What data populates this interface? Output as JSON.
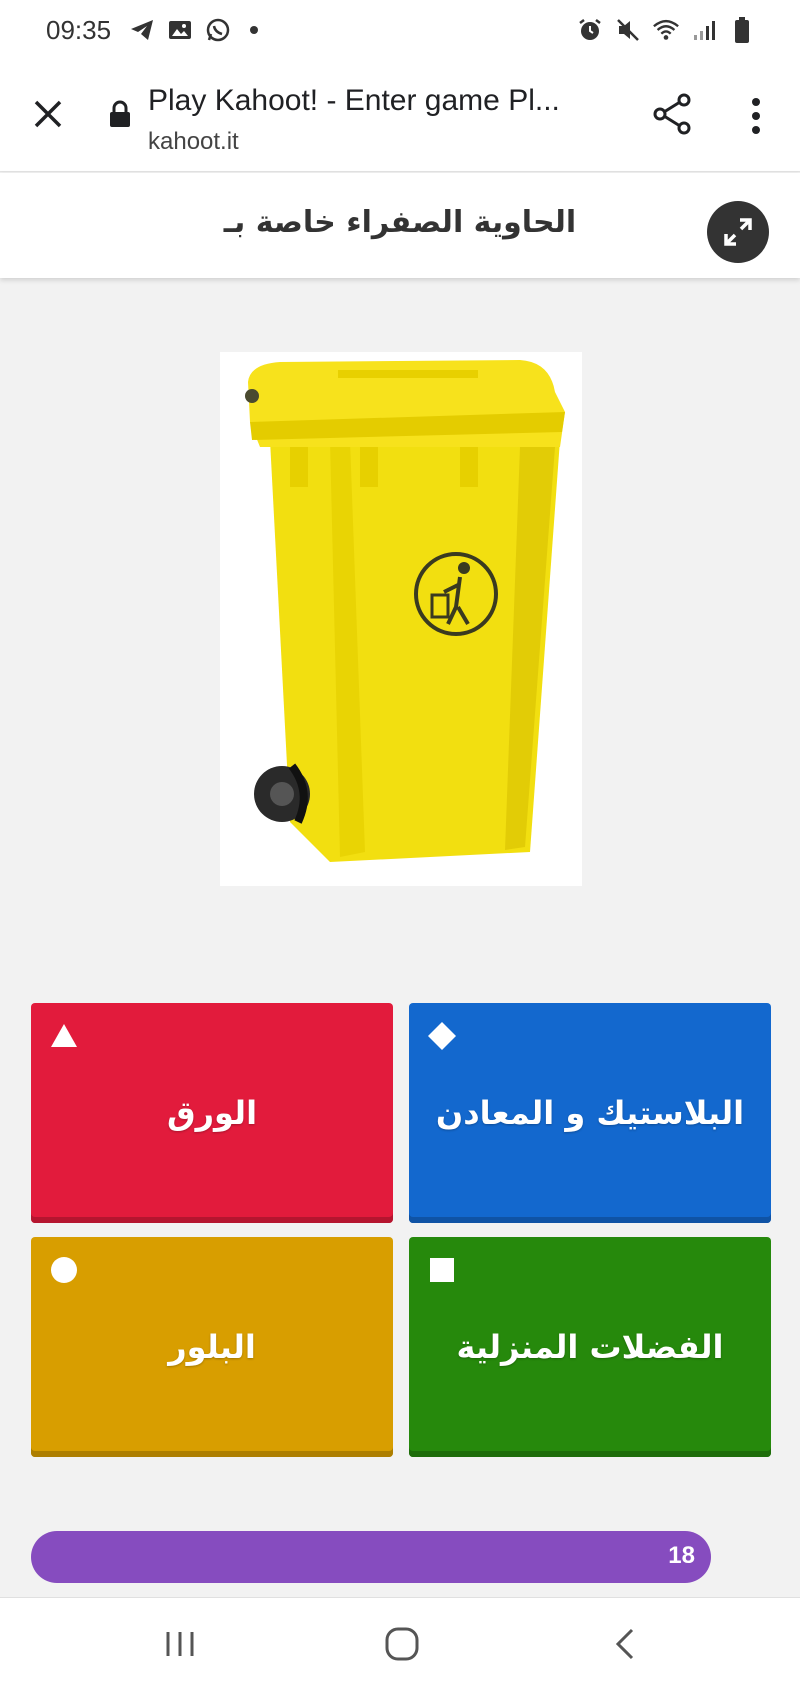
{
  "status_bar": {
    "time": "09:35",
    "left_icons": [
      "telegram-icon",
      "gallery-icon",
      "whatsapp-icon",
      "dot-icon"
    ],
    "right_icons": [
      "alarm-icon",
      "mute-icon",
      "wifi-icon",
      "signal-icon",
      "battery-icon"
    ]
  },
  "browser": {
    "title": "Play Kahoot! - Enter game Pl...",
    "url": "kahoot.it",
    "close_icon": "close-icon",
    "lock_icon": "lock-icon",
    "share_icon": "share-icon",
    "menu_icon": "more-vert-icon"
  },
  "question": {
    "text": "الحاوية الصفراء خاصة بـ",
    "expand_icon": "expand-icon"
  },
  "answers": [
    {
      "label": "الورق",
      "shape": "triangle",
      "color": "#e21b3c"
    },
    {
      "label": "البلاستيك و المعادن",
      "shape": "diamond",
      "color": "#1368ce"
    },
    {
      "label": "البلور",
      "shape": "circle",
      "color": "#d89e00"
    },
    {
      "label": "الفضلات المنزلية",
      "shape": "square",
      "color": "#26890c"
    }
  ],
  "timer": {
    "count": "18",
    "color": "#864cbf"
  },
  "nav": {
    "recents_icon": "recents-icon",
    "home_icon": "home-icon",
    "back_icon": "back-icon"
  }
}
